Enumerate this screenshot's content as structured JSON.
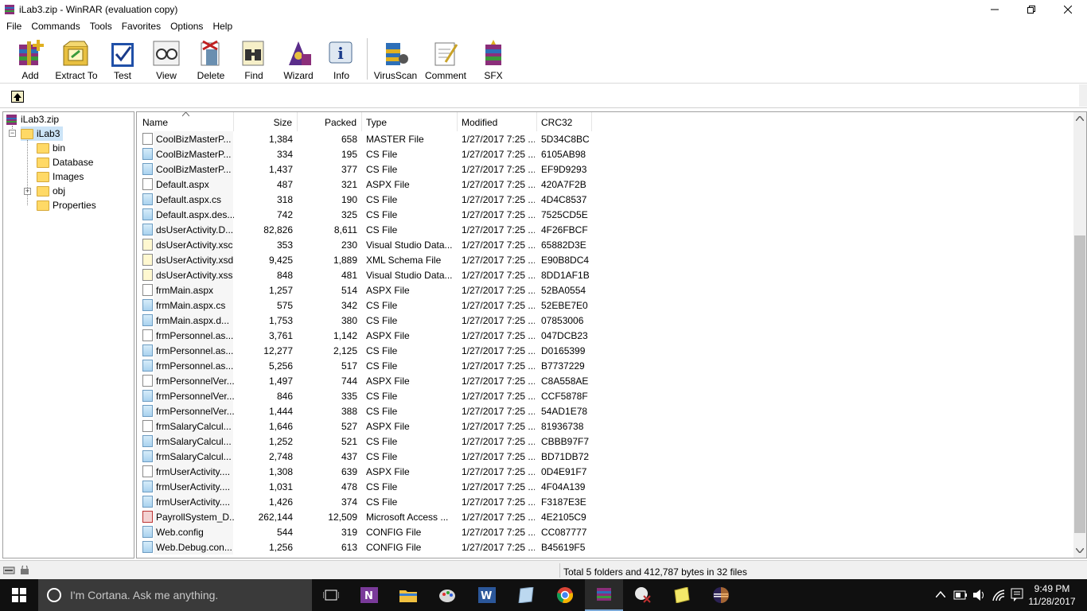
{
  "window": {
    "title": "iLab3.zip - WinRAR (evaluation copy)"
  },
  "menu": [
    "File",
    "Commands",
    "Tools",
    "Favorites",
    "Options",
    "Help"
  ],
  "toolbar": [
    {
      "label": "Add",
      "icon": "add-icon"
    },
    {
      "label": "Extract To",
      "icon": "extract-icon"
    },
    {
      "label": "Test",
      "icon": "test-icon"
    },
    {
      "label": "View",
      "icon": "view-icon"
    },
    {
      "label": "Delete",
      "icon": "delete-icon"
    },
    {
      "label": "Find",
      "icon": "find-icon"
    },
    {
      "label": "Wizard",
      "icon": "wizard-icon"
    },
    {
      "label": "Info",
      "icon": "info-icon"
    },
    {
      "label": "VirusScan",
      "icon": "virusscan-icon"
    },
    {
      "label": "Comment",
      "icon": "comment-icon"
    },
    {
      "label": "SFX",
      "icon": "sfx-icon"
    }
  ],
  "tree": {
    "root": "iLab3.zip",
    "folder": "iLab3",
    "children": [
      "bin",
      "Database",
      "Images",
      "obj",
      "Properties"
    ]
  },
  "columns": [
    "Name",
    "Size",
    "Packed",
    "Type",
    "Modified",
    "CRC32"
  ],
  "files": [
    {
      "name": "CoolBizMasterP...",
      "size": "1,384",
      "packed": "658",
      "type": "MASTER File",
      "modified": "1/27/2017 7:25 ...",
      "crc": "5D34C8BC",
      "kind": "plain"
    },
    {
      "name": "CoolBizMasterP...",
      "size": "334",
      "packed": "195",
      "type": "CS File",
      "modified": "1/27/2017 7:25 ...",
      "crc": "6105AB98",
      "kind": "cs"
    },
    {
      "name": "CoolBizMasterP...",
      "size": "1,437",
      "packed": "377",
      "type": "CS File",
      "modified": "1/27/2017 7:25 ...",
      "crc": "EF9D9293",
      "kind": "cs"
    },
    {
      "name": "Default.aspx",
      "size": "487",
      "packed": "321",
      "type": "ASPX File",
      "modified": "1/27/2017 7:25 ...",
      "crc": "420A7F2B",
      "kind": "plain"
    },
    {
      "name": "Default.aspx.cs",
      "size": "318",
      "packed": "190",
      "type": "CS File",
      "modified": "1/27/2017 7:25 ...",
      "crc": "4D4C8537",
      "kind": "cs"
    },
    {
      "name": "Default.aspx.des...",
      "size": "742",
      "packed": "325",
      "type": "CS File",
      "modified": "1/27/2017 7:25 ...",
      "crc": "7525CD5E",
      "kind": "cs"
    },
    {
      "name": "dsUserActivity.D...",
      "size": "82,826",
      "packed": "8,611",
      "type": "CS File",
      "modified": "1/27/2017 7:25 ...",
      "crc": "4F26FBCF",
      "kind": "cs"
    },
    {
      "name": "dsUserActivity.xsc",
      "size": "353",
      "packed": "230",
      "type": "Visual Studio Data...",
      "modified": "1/27/2017 7:25 ...",
      "crc": "65882D3E",
      "kind": "xsc"
    },
    {
      "name": "dsUserActivity.xsd",
      "size": "9,425",
      "packed": "1,889",
      "type": "XML Schema File",
      "modified": "1/27/2017 7:25 ...",
      "crc": "E90B8DC4",
      "kind": "xsc"
    },
    {
      "name": "dsUserActivity.xss",
      "size": "848",
      "packed": "481",
      "type": "Visual Studio Data...",
      "modified": "1/27/2017 7:25 ...",
      "crc": "8DD1AF1B",
      "kind": "xsc"
    },
    {
      "name": "frmMain.aspx",
      "size": "1,257",
      "packed": "514",
      "type": "ASPX File",
      "modified": "1/27/2017 7:25 ...",
      "crc": "52BA0554",
      "kind": "plain"
    },
    {
      "name": "frmMain.aspx.cs",
      "size": "575",
      "packed": "342",
      "type": "CS File",
      "modified": "1/27/2017 7:25 ...",
      "crc": "52EBE7E0",
      "kind": "cs"
    },
    {
      "name": "frmMain.aspx.d...",
      "size": "1,753",
      "packed": "380",
      "type": "CS File",
      "modified": "1/27/2017 7:25 ...",
      "crc": "07853006",
      "kind": "cs"
    },
    {
      "name": "frmPersonnel.as...",
      "size": "3,761",
      "packed": "1,142",
      "type": "ASPX File",
      "modified": "1/27/2017 7:25 ...",
      "crc": "047DCB23",
      "kind": "plain"
    },
    {
      "name": "frmPersonnel.as...",
      "size": "12,277",
      "packed": "2,125",
      "type": "CS File",
      "modified": "1/27/2017 7:25 ...",
      "crc": "D0165399",
      "kind": "cs"
    },
    {
      "name": "frmPersonnel.as...",
      "size": "5,256",
      "packed": "517",
      "type": "CS File",
      "modified": "1/27/2017 7:25 ...",
      "crc": "B7737229",
      "kind": "cs"
    },
    {
      "name": "frmPersonnelVer...",
      "size": "1,497",
      "packed": "744",
      "type": "ASPX File",
      "modified": "1/27/2017 7:25 ...",
      "crc": "C8A558AE",
      "kind": "plain"
    },
    {
      "name": "frmPersonnelVer...",
      "size": "846",
      "packed": "335",
      "type": "CS File",
      "modified": "1/27/2017 7:25 ...",
      "crc": "CCF5878F",
      "kind": "cs"
    },
    {
      "name": "frmPersonnelVer...",
      "size": "1,444",
      "packed": "388",
      "type": "CS File",
      "modified": "1/27/2017 7:25 ...",
      "crc": "54AD1E78",
      "kind": "cs"
    },
    {
      "name": "frmSalaryCalcul...",
      "size": "1,646",
      "packed": "527",
      "type": "ASPX File",
      "modified": "1/27/2017 7:25 ...",
      "crc": "81936738",
      "kind": "plain"
    },
    {
      "name": "frmSalaryCalcul...",
      "size": "1,252",
      "packed": "521",
      "type": "CS File",
      "modified": "1/27/2017 7:25 ...",
      "crc": "CBBB97F7",
      "kind": "cs"
    },
    {
      "name": "frmSalaryCalcul...",
      "size": "2,748",
      "packed": "437",
      "type": "CS File",
      "modified": "1/27/2017 7:25 ...",
      "crc": "BD71DB72",
      "kind": "cs"
    },
    {
      "name": "frmUserActivity....",
      "size": "1,308",
      "packed": "639",
      "type": "ASPX File",
      "modified": "1/27/2017 7:25 ...",
      "crc": "0D4E91F7",
      "kind": "plain"
    },
    {
      "name": "frmUserActivity....",
      "size": "1,031",
      "packed": "478",
      "type": "CS File",
      "modified": "1/27/2017 7:25 ...",
      "crc": "4F04A139",
      "kind": "cs"
    },
    {
      "name": "frmUserActivity....",
      "size": "1,426",
      "packed": "374",
      "type": "CS File",
      "modified": "1/27/2017 7:25 ...",
      "crc": "F3187E3E",
      "kind": "cs"
    },
    {
      "name": "PayrollSystem_D...",
      "size": "262,144",
      "packed": "12,509",
      "type": "Microsoft Access ...",
      "modified": "1/27/2017 7:25 ...",
      "crc": "4E2105C9",
      "kind": "acc"
    },
    {
      "name": "Web.config",
      "size": "544",
      "packed": "319",
      "type": "CONFIG File",
      "modified": "1/27/2017 7:25 ...",
      "crc": "CC087777",
      "kind": "cs"
    },
    {
      "name": "Web.Debug.con...",
      "size": "1,256",
      "packed": "613",
      "type": "CONFIG File",
      "modified": "1/27/2017 7:25 ...",
      "crc": "B45619F5",
      "kind": "cs"
    }
  ],
  "status": {
    "summary": "Total 5 folders and 412,787 bytes in 32 files"
  },
  "taskbar": {
    "search_placeholder": "I'm Cortana. Ask me anything.",
    "time": "9:49 PM",
    "date": "11/28/2017"
  }
}
